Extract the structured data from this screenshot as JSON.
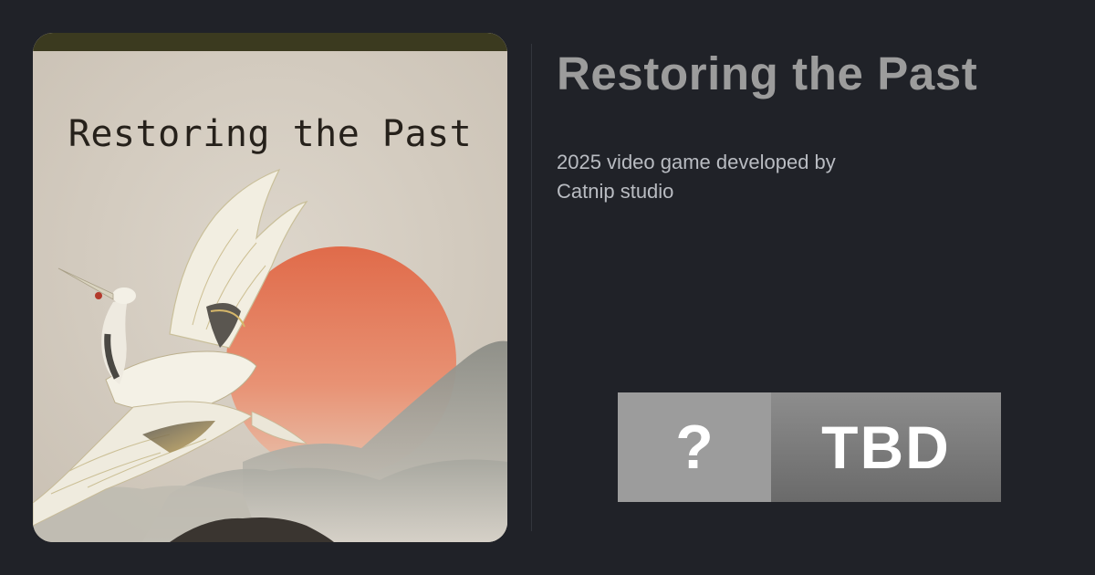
{
  "cover": {
    "title_text": "Restoring the Past",
    "art_subject": "crane-over-sun-and-mountains"
  },
  "game": {
    "title": "Restoring the Past",
    "description": "2025 video game developed by Catnip studio"
  },
  "score": {
    "symbol": "?",
    "label": "TBD"
  },
  "colors": {
    "background": "#202228",
    "title": "#9c9c9c",
    "description": "#b9bcc2",
    "sun": "#e07a5a",
    "score_dark": "#7a7a7a",
    "score_light": "#9c9c9c"
  }
}
